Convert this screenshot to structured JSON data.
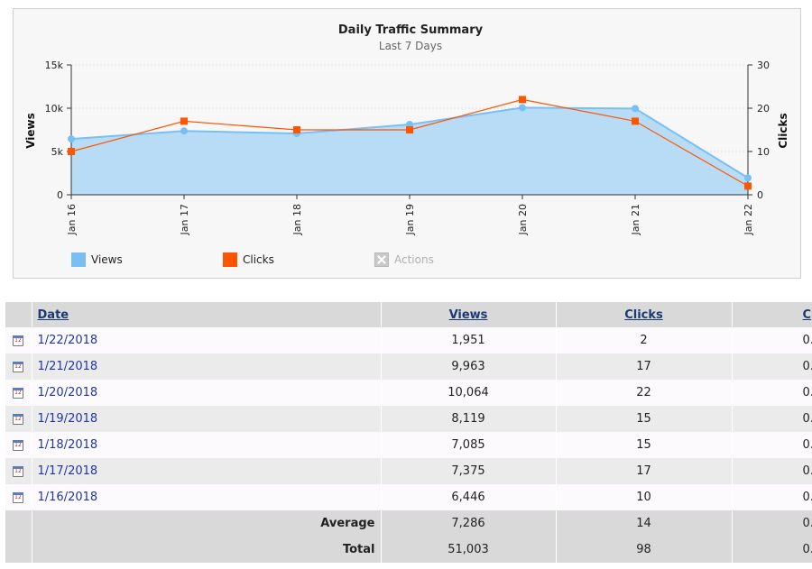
{
  "chart": {
    "title": "Daily Traffic Summary",
    "subtitle": "Last 7 Days",
    "legend": [
      {
        "label": "Views",
        "color": "#78bff5",
        "enabled": true
      },
      {
        "label": "Clicks",
        "color": "#ff5500",
        "enabled": true
      },
      {
        "label": "Actions",
        "color": "#c8c8c8",
        "enabled": false
      }
    ]
  },
  "chart_data": {
    "type": "area",
    "title": "Daily Traffic Summary",
    "subtitle": "Last 7 Days",
    "categories": [
      "Jan 16",
      "Jan 17",
      "Jan 18",
      "Jan 19",
      "Jan 20",
      "Jan 21",
      "Jan 22"
    ],
    "series": [
      {
        "name": "Views",
        "axis": "left",
        "kind": "area",
        "color": "#78bff5",
        "fill": "#b9dcf6",
        "values": [
          6446,
          7375,
          7085,
          8119,
          10064,
          9963,
          1951
        ]
      },
      {
        "name": "Clicks",
        "axis": "right",
        "kind": "line",
        "color": "#ff5500",
        "values": [
          10,
          17,
          15,
          15,
          22,
          17,
          2
        ]
      }
    ],
    "ylabel_left": "Views",
    "ylabel_right": "Clicks",
    "ylim_left": [
      0,
      15000
    ],
    "ylim_right": [
      0,
      30
    ],
    "yticks_left": [
      "0",
      "5k",
      "10k",
      "15k"
    ],
    "yticks_right": [
      "0",
      "10",
      "20",
      "30"
    ],
    "legend_position": "bottom-left",
    "grid": true
  },
  "table": {
    "headers": {
      "date": "Date",
      "views": "Views",
      "clicks": "Clicks",
      "ctr": "C"
    },
    "rows": [
      {
        "date": "1/22/2018",
        "views": "1,951",
        "clicks": "2",
        "ctr": "0."
      },
      {
        "date": "1/21/2018",
        "views": "9,963",
        "clicks": "17",
        "ctr": "0."
      },
      {
        "date": "1/20/2018",
        "views": "10,064",
        "clicks": "22",
        "ctr": "0."
      },
      {
        "date": "1/19/2018",
        "views": "8,119",
        "clicks": "15",
        "ctr": "0."
      },
      {
        "date": "1/18/2018",
        "views": "7,085",
        "clicks": "15",
        "ctr": "0."
      },
      {
        "date": "1/17/2018",
        "views": "7,375",
        "clicks": "17",
        "ctr": "0."
      },
      {
        "date": "1/16/2018",
        "views": "6,446",
        "clicks": "10",
        "ctr": "0."
      }
    ],
    "row_icon": "calendar-icon",
    "row_icon_text": "12",
    "average": {
      "label": "Average",
      "views": "7,286",
      "clicks": "14",
      "ctr": "0."
    },
    "total": {
      "label": "Total",
      "views": "51,003",
      "clicks": "98",
      "ctr": "0."
    }
  }
}
